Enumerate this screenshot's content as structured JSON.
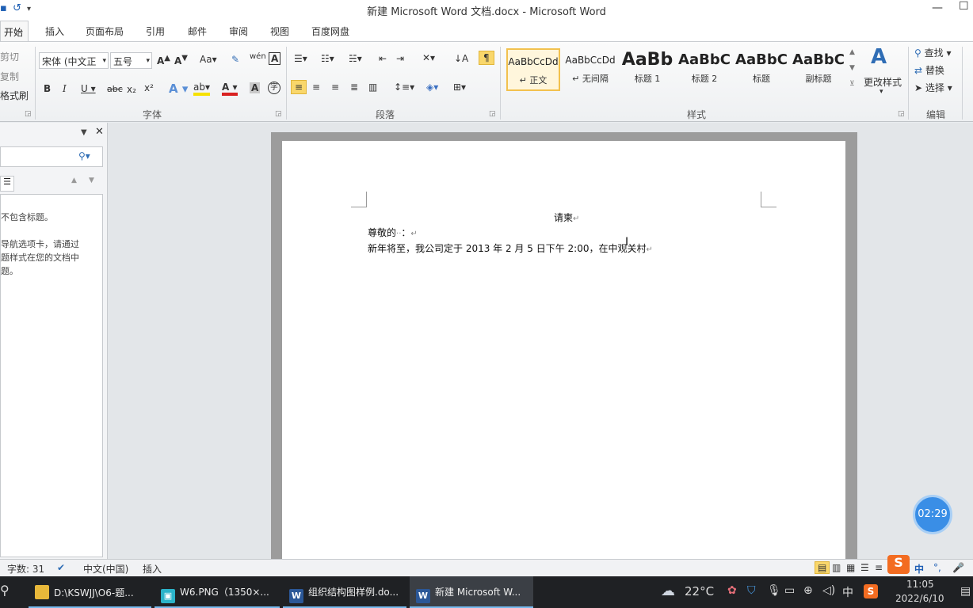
{
  "window": {
    "title": "新建 Microsoft Word 文档.docx - Microsoft Word"
  },
  "quick_access": {
    "save_icon": "save-icon",
    "undo_icon": "undo-icon"
  },
  "tabs": [
    "开始",
    "插入",
    "页面布局",
    "引用",
    "邮件",
    "审阅",
    "视图",
    "百度网盘"
  ],
  "clipboard": {
    "cut": "剪切",
    "copy": "复制",
    "format_painter": "格式刷"
  },
  "font": {
    "name": "宋体 (中文正",
    "size": "五号",
    "group_label": "字体"
  },
  "paragraph": {
    "group_label": "段落"
  },
  "styles": {
    "group_label": "样式",
    "items": [
      {
        "preview": "AaBbCcDd",
        "label": "↵ 正文"
      },
      {
        "preview": "AaBbCcDd",
        "label": "↵ 无间隔"
      },
      {
        "preview": "AaBb",
        "label": "标题 1"
      },
      {
        "preview": "AaBbC",
        "label": "标题 2"
      },
      {
        "preview": "AaBbC",
        "label": "标题"
      },
      {
        "preview": "AaBbC",
        "label": "副标题"
      }
    ],
    "change_styles": "更改样式"
  },
  "editing": {
    "find": "查找",
    "replace": "替换",
    "select": "选择",
    "group_label": "编辑"
  },
  "nav_pane": {
    "messages": [
      "不包含标题。",
      "导航选项卡，请通过",
      "题样式在您的文档中",
      "题。"
    ]
  },
  "document": {
    "line1": "请柬",
    "line2": "尊敬的",
    "line2_colon": "：",
    "line3": "新年将至，我公司定于 2013 年 2 月 5 日下午 2:00，在中观关村"
  },
  "timer": "02:29",
  "status": {
    "word_count": "字数: 31",
    "language": "中文(中国)",
    "mode": "插入"
  },
  "ime": {
    "mode": "中"
  },
  "taskbar": {
    "items": [
      "D:\\KSWJJ\\O6-题...",
      "W6.PNG（1350×...",
      "组织结构图样例.do...",
      "新建 Microsoft W..."
    ],
    "weather": "22°C",
    "ime": "中",
    "time": "11:05",
    "date": "2022/6/10"
  }
}
